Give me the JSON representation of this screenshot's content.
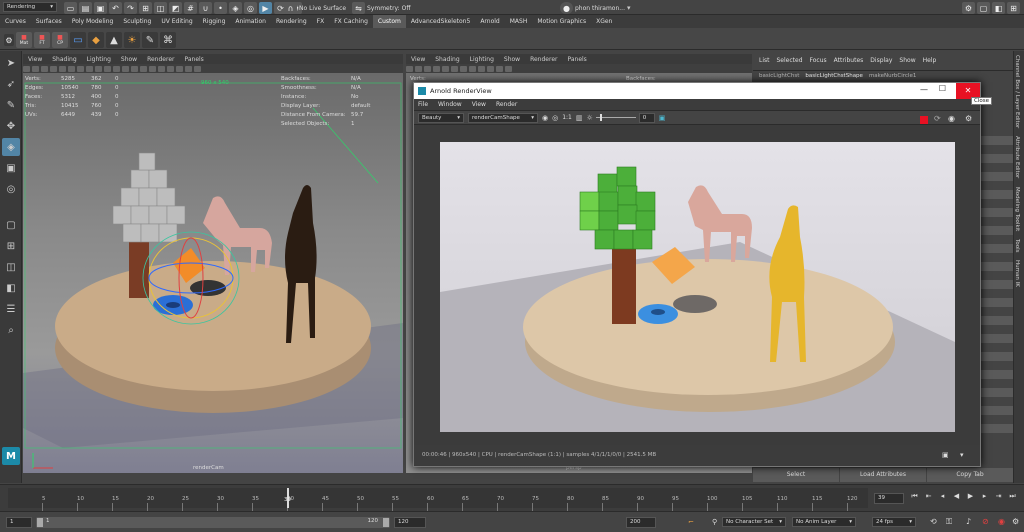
{
  "topbar": {
    "menuset": "Rendering",
    "live_surface": "No Live Surface",
    "symmetry": "Symmetry: Off",
    "user": "phon thiramon..."
  },
  "shelf_tabs": [
    "Curves",
    "Surfaces",
    "Poly Modeling",
    "Sculpting",
    "UV Editing",
    "Rigging",
    "Animation",
    "Rendering",
    "FX",
    "FX Caching",
    "Custom",
    "AdvancedSkeleton5",
    "Arnold",
    "MASH",
    "Motion Graphics",
    "XGen"
  ],
  "shelf_tab_active": "Custom",
  "shelf_icons": [
    "Mat",
    "FT",
    "CP"
  ],
  "viewport1": {
    "menu": [
      "View",
      "Shading",
      "Lighting",
      "Show",
      "Renderer",
      "Panels"
    ],
    "hud_left": [
      {
        "label": "Verts:",
        "a": "5285",
        "b": "362",
        "c": "0"
      },
      {
        "label": "Edges:",
        "a": "10540",
        "b": "780",
        "c": "0"
      },
      {
        "label": "Faces:",
        "a": "5312",
        "b": "400",
        "c": "0"
      },
      {
        "label": "Tris:",
        "a": "10415",
        "b": "760",
        "c": "0"
      },
      {
        "label": "UVs:",
        "a": "6449",
        "b": "439",
        "c": "0"
      }
    ],
    "hud_right": [
      {
        "label": "Backfaces:",
        "value": "N/A"
      },
      {
        "label": "Smoothness:",
        "value": "N/A"
      },
      {
        "label": "Instance:",
        "value": "No"
      },
      {
        "label": "Display Layer:",
        "value": "default"
      },
      {
        "label": "Distance From Camera:",
        "value": "59.7"
      },
      {
        "label": "Selected Objects:",
        "value": "1"
      }
    ],
    "resolution_gate": "960 x 540",
    "camera": "renderCam"
  },
  "viewport2": {
    "menu": [
      "View",
      "Shading",
      "Lighting",
      "Show",
      "Renderer",
      "Panels"
    ],
    "hud_partial": [
      "Verts:",
      "Backfaces:"
    ],
    "camera": "persp"
  },
  "renderview": {
    "title": "Arnold RenderView",
    "close_tooltip": "Close",
    "menu": [
      "File",
      "Window",
      "View",
      "Render"
    ],
    "aov": "Beauty",
    "camera": "renderCamShape",
    "ratio": "1:1",
    "exposure": "0",
    "status": "00:00:46 | 960x540 | CPU | renderCamShape (1:1) | samples 4/1/1/1/0/0 | 2541.5 MB"
  },
  "attribute_editor": {
    "menu": [
      "List",
      "Selected",
      "Focus",
      "Attributes",
      "Display",
      "Show",
      "Help"
    ],
    "tabs": [
      "basicLightChst",
      "basicLightChstShape",
      "makeNurbCircle1"
    ],
    "buttons": [
      "Select",
      "Load Attributes",
      "Copy Tab"
    ]
  },
  "right_tabs": [
    "Channel Box / Layer Editor",
    "Attribute Editor",
    "Modeling Toolkit",
    "Tools",
    "Human IK"
  ],
  "timeline": {
    "ticks": [
      "5",
      "10",
      "15",
      "20",
      "25",
      "30",
      "35",
      "40",
      "45",
      "50",
      "55",
      "60",
      "65",
      "70",
      "75",
      "80",
      "85",
      "90",
      "95",
      "100",
      "105",
      "110",
      "115",
      "120"
    ],
    "current_frame": "39",
    "playhead_label": "39"
  },
  "range": {
    "start": "1",
    "range_start": "1",
    "range_end": "120",
    "end": "120",
    "anim_end": "200",
    "character_set": "No Character Set",
    "anim_layer": "No Anim Layer",
    "fps": "24 fps"
  },
  "colors": {
    "accent": "#5285a6",
    "close_red": "#e81123",
    "ui_bg": "#444444"
  }
}
